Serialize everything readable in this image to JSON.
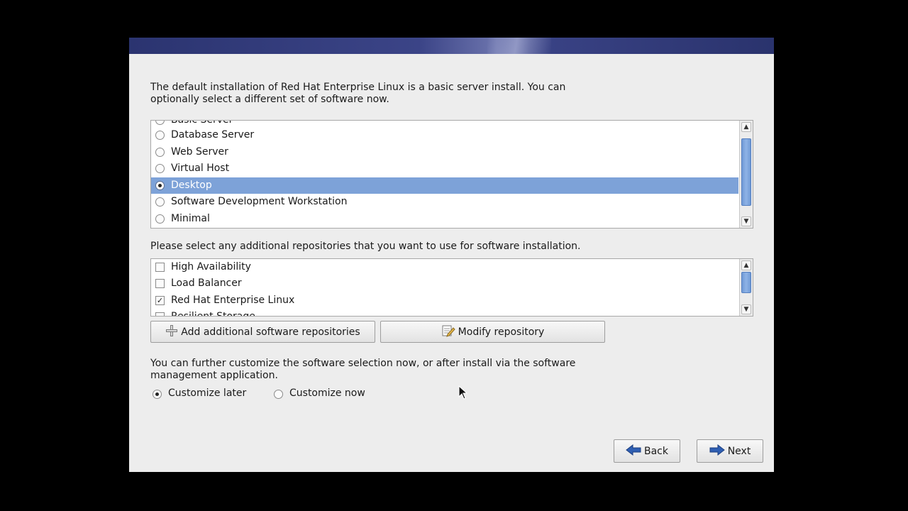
{
  "intro_text_line1": "The default installation of Red Hat Enterprise Linux is a basic server install. You can",
  "intro_text_line2": "optionally select a different set of software now.",
  "software_sets": [
    {
      "label": "Basic Server",
      "selected": false
    },
    {
      "label": "Database Server",
      "selected": false
    },
    {
      "label": "Web Server",
      "selected": false
    },
    {
      "label": "Virtual Host",
      "selected": false
    },
    {
      "label": "Desktop",
      "selected": true
    },
    {
      "label": "Software Development Workstation",
      "selected": false
    },
    {
      "label": "Minimal",
      "selected": false
    }
  ],
  "repos_text": "Please select any additional repositories that you want to use for software installation.",
  "repositories": [
    {
      "label": "High Availability",
      "checked": false
    },
    {
      "label": "Load Balancer",
      "checked": false
    },
    {
      "label": "Red Hat Enterprise Linux",
      "checked": true
    },
    {
      "label": "Resilient Storage",
      "checked": false
    }
  ],
  "buttons": {
    "add_repos": "Add additional software repositories",
    "modify_repo": "Modify repository",
    "back": "Back",
    "next": "Next"
  },
  "customize_text_line1": "You can further customize the software selection now, or after install via the software",
  "customize_text_line2": "management application.",
  "customize_options": {
    "later": "Customize later",
    "now": "Customize now",
    "selected": "later"
  },
  "colors": {
    "selection": "#7da2d8",
    "banner": "#2b3470",
    "arrow_blue": "#2f5fb3"
  }
}
